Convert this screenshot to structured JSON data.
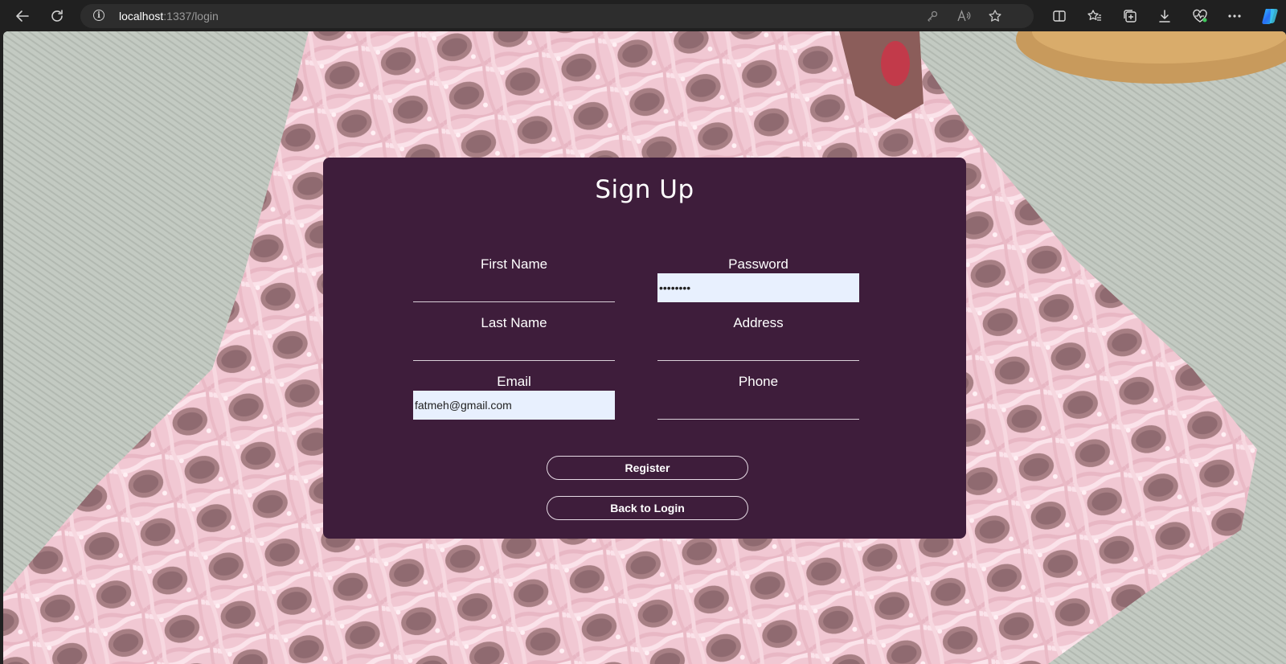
{
  "browser": {
    "url_host": "localhost",
    "url_path": ":1337/login",
    "icons": [
      "back-arrow-icon",
      "refresh-icon",
      "info-icon",
      "key-icon",
      "read-aloud-icon",
      "favorite-star-icon",
      "split-screen-icon",
      "favorites-list-icon",
      "collections-icon",
      "download-icon",
      "heart-pulse-icon",
      "more-options-icon",
      "copilot-icon"
    ]
  },
  "form": {
    "title": "Sign Up",
    "fields": {
      "first_name": {
        "label": "First Name",
        "value": ""
      },
      "last_name": {
        "label": "Last Name",
        "value": ""
      },
      "email": {
        "label": "Email",
        "value": "fatmeh@gmail.com"
      },
      "password": {
        "label": "Password",
        "value": "••••••••"
      },
      "address": {
        "label": "Address",
        "value": ""
      },
      "phone": {
        "label": "Phone",
        "value": ""
      }
    },
    "register_label": "Register",
    "back_label": "Back to Login"
  },
  "colors": {
    "card_background": "#3e1d3b",
    "autofill_background": "#e8f0fe",
    "background_photo_tone": "#f3c9d4"
  }
}
